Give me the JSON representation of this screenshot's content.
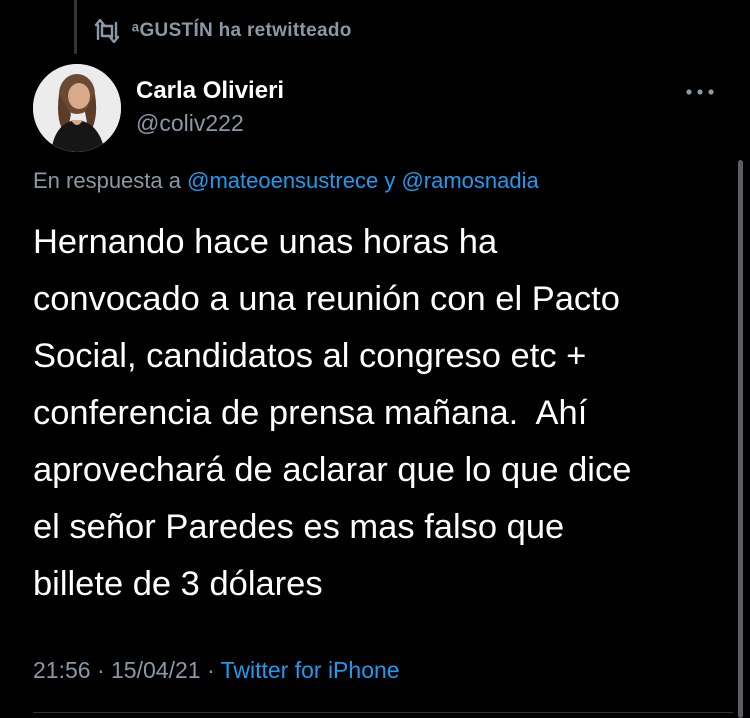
{
  "retweet": {
    "label": "ᵃGUSTÍN ha retwitteado"
  },
  "author": {
    "name": "Carla Olivieri",
    "handle": "@coliv222"
  },
  "reply": {
    "prefix": "En respuesta a",
    "mention_1": "@mateoensustrece",
    "connector": "y",
    "mention_2": "@ramosnadia"
  },
  "tweet": {
    "lines": [
      "Hernando hace unas horas ha",
      "convocado a una reunión con el Pacto",
      "Social, candidatos al congreso etc +",
      "conferencia de prensa mañana.  Ahí",
      "aprovechará de aclarar que lo que dice",
      "el señor Paredes es mas falso que",
      "billete de 3 dólares"
    ]
  },
  "meta": {
    "time": "21:56",
    "separator_1": "·",
    "date": "15/04/21",
    "separator_2": "·",
    "source": "Twitter for iPhone"
  },
  "icons": {
    "retweet": "retweet-icon",
    "more": "more-icon"
  },
  "colors": {
    "background": "#000000",
    "primary_text": "#ffffff",
    "secondary_text": "#8b98a5",
    "link": "#1d9bf0"
  }
}
